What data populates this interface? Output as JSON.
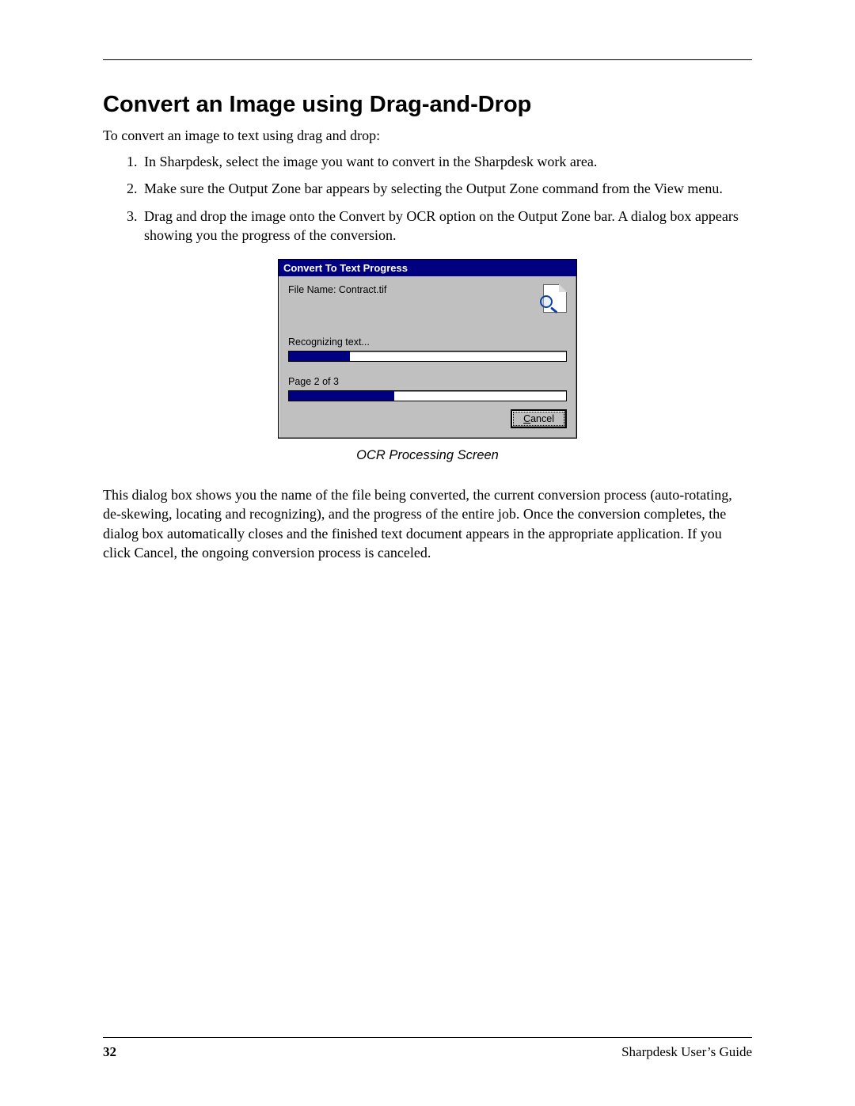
{
  "heading": "Convert an Image using Drag-and-Drop",
  "intro": "To convert an image to text using drag and drop:",
  "steps": [
    "In Sharpdesk, select the image you want to convert in the Sharpdesk work area.",
    "Make sure the Output Zone bar appears by selecting the Output Zone command from the View menu.",
    "Drag and drop the image onto the Convert by OCR option on the Output Zone bar. A dialog box appears showing you the progress of the conversion."
  ],
  "dialog": {
    "title": "Convert To Text Progress",
    "filename_label": "File Name: Contract.tif",
    "recognizing_label": "Recognizing text...",
    "recognizing_percent": 22,
    "page_label": "Page 2 of 3",
    "page_percent": 38,
    "cancel_letter": "C",
    "cancel_rest": "ancel"
  },
  "caption": "OCR Processing Screen",
  "bodypara": "This dialog box shows you the name of the file being converted, the current conversion process (auto-rotating, de-skewing, locating and recognizing), and the progress of the entire job.  Once the conversion completes, the dialog box automatically closes and the finished text document appears in the appropriate application. If you click Cancel, the ongoing conversion process is canceled.",
  "footer": {
    "page": "32",
    "guide": "Sharpdesk User’s Guide"
  }
}
